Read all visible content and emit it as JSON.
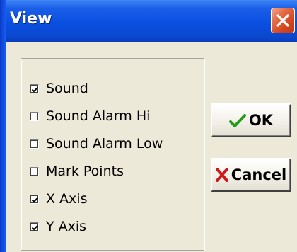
{
  "window": {
    "title": "View",
    "close_icon": "close-x"
  },
  "options": [
    {
      "label": "Sound",
      "checked": true
    },
    {
      "label": "Sound Alarm Hi",
      "checked": false
    },
    {
      "label": "Sound Alarm Low",
      "checked": false
    },
    {
      "label": "Mark Points",
      "checked": false
    },
    {
      "label": "X Axis",
      "checked": true
    },
    {
      "label": "Y Axis",
      "checked": true
    }
  ],
  "buttons": {
    "ok_label": "OK",
    "ok_icon": "green-checkmark",
    "cancel_label": "Cancel",
    "cancel_icon": "red-x"
  },
  "colors": {
    "titlebar": "#0a4fe0",
    "close": "#d3451e",
    "face": "#ece9d8",
    "ok_icon": "#2a9a1e",
    "cancel_icon": "#d01818"
  }
}
